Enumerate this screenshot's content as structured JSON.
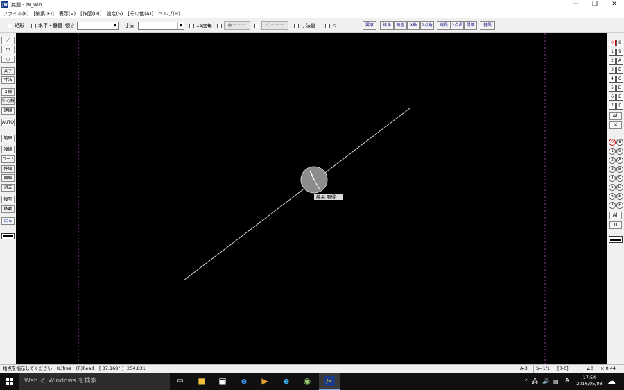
{
  "window": {
    "app_icon_text": "Jw",
    "title": "無題 - jw_win",
    "minimize_glyph": "─",
    "restore_glyph": "❐",
    "close_glyph": "✕"
  },
  "menu": [
    "ファイル(F)",
    "[編集(E)]",
    "表示(V)",
    "[作図(D)]",
    "設定(S)",
    "[その他(A)]",
    "ヘルプ(H)"
  ],
  "options": {
    "rect_label": "矩形",
    "hv_label": "水平・垂直",
    "slope_label": "傾き",
    "slope_value": "",
    "dim_label": "寸法",
    "dim_value": "",
    "deg15_label": "15度毎",
    "dot_btn": "●－－－",
    "arrow_btn": "＜－－－",
    "dimvalue_label": "寸法値",
    "lt_label": "＜",
    "buttons": [
      "属取",
      "線角",
      "鉛直",
      "X軸",
      "2点角",
      "線長",
      "2点長",
      "間隔",
      "基設"
    ]
  },
  "left_tools": {
    "line": "／",
    "rect": "□",
    "circle": "○",
    "text": "文字",
    "dim": "寸法",
    "double_line": "２線",
    "center_line": "中心線",
    "continuous": "連線",
    "auto": "AUTO",
    "range": "範囲",
    "copy_line": "複線",
    "corner": "コーナー",
    "stretch": "伸縮",
    "chamfer": "面取",
    "erase": "消去",
    "duplicate": "複写",
    "move": "移動",
    "undo": "戻る"
  },
  "layers": {
    "group_labels": [
      "0",
      "8",
      "1",
      "9",
      "2",
      "A",
      "3",
      "B",
      "4",
      "C",
      "5",
      "D",
      "6",
      "E",
      "7",
      "F"
    ],
    "all": "All",
    "x": "✕",
    "layer_labels": [
      "0",
      "8",
      "1",
      "9",
      "2",
      "A",
      "3",
      "B",
      "4",
      "C",
      "5",
      "D",
      "6",
      "E",
      "7",
      "F"
    ],
    "zero": "0"
  },
  "canvas": {
    "tooltip": "線長 取得",
    "background": "#000000",
    "line_color": "#d8d8d8",
    "frame_color": "#9a3aa0"
  },
  "status": {
    "prompt": "始点を指示してください　(L)free　(R)Read",
    "angle": "[ 37.168° ]",
    "length": "254.831",
    "paper": "A-3",
    "scale": "S=1/1",
    "layer": "[0-0]",
    "rotation": "∠0",
    "zoom": "× 0.44"
  },
  "taskbar": {
    "search_placeholder": "Web と Windows を検索",
    "ime": "A",
    "time": "17:54",
    "date": "2016/05/08",
    "active_app_text": "Jw"
  }
}
